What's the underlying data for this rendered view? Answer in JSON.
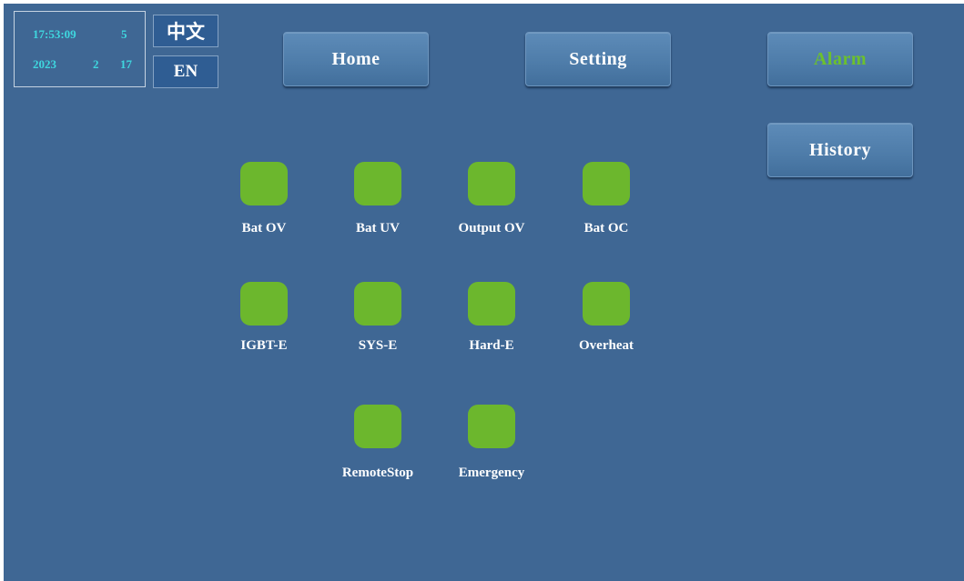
{
  "clock": {
    "time": "17:53:09",
    "weekday": "5",
    "year": "2023",
    "month": "2",
    "day": "17"
  },
  "language": {
    "chinese": "中文",
    "english": "EN"
  },
  "nav": {
    "home": "Home",
    "setting": "Setting",
    "alarm": "Alarm",
    "history": "History"
  },
  "colors": {
    "background": "#3f6794",
    "indicator_normal": "#6cb72d",
    "alarm_active_text": "#6cc02e",
    "clock_text": "#3fd7df"
  },
  "indicators": [
    {
      "label": "Bat OV",
      "status": "normal"
    },
    {
      "label": "Bat UV",
      "status": "normal"
    },
    {
      "label": "Output OV",
      "status": "normal"
    },
    {
      "label": "Bat OC",
      "status": "normal"
    },
    {
      "label": "IGBT-E",
      "status": "normal"
    },
    {
      "label": "SYS-E",
      "status": "normal"
    },
    {
      "label": "Hard-E",
      "status": "normal"
    },
    {
      "label": "Overheat",
      "status": "normal"
    },
    {
      "label": "RemoteStop",
      "status": "normal"
    },
    {
      "label": "Emergency",
      "status": "normal"
    }
  ]
}
